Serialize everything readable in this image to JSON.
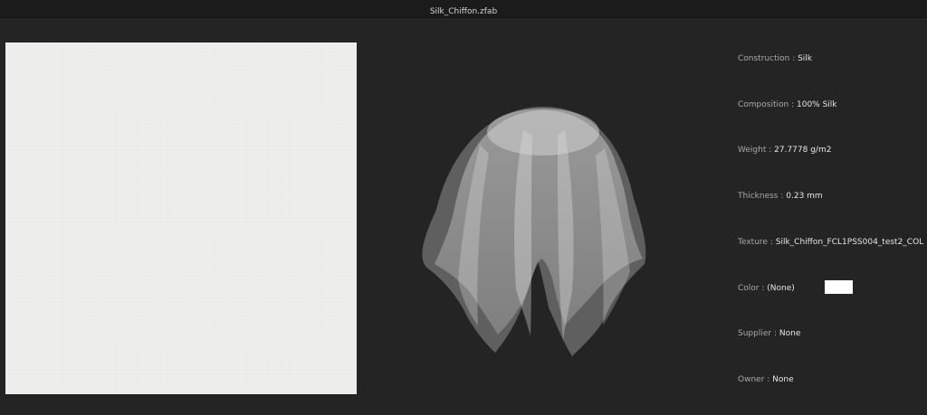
{
  "window": {
    "title": "Silk_Chiffon.zfab"
  },
  "properties": [
    {
      "key": "Construction",
      "value": "Silk"
    },
    {
      "key": "Composition",
      "value": "100% Silk"
    },
    {
      "key": "Weight",
      "value": "27.7778 g/m2"
    },
    {
      "key": "Thickness",
      "value": "0.23 mm"
    },
    {
      "key": "Texture",
      "value": "Silk_Chiffon_FCL1PSS004_test2_COL"
    },
    {
      "key": "Color",
      "value": "(None)",
      "swatch": "#ffffff"
    },
    {
      "key": "Supplier",
      "value": "None"
    },
    {
      "key": "Owner",
      "value": "None"
    }
  ],
  "separator": ":",
  "colors": {
    "background": "#242424",
    "titlebar": "#1b1b1b",
    "texture": "#ededea",
    "fabric": "#d8d8d8"
  }
}
